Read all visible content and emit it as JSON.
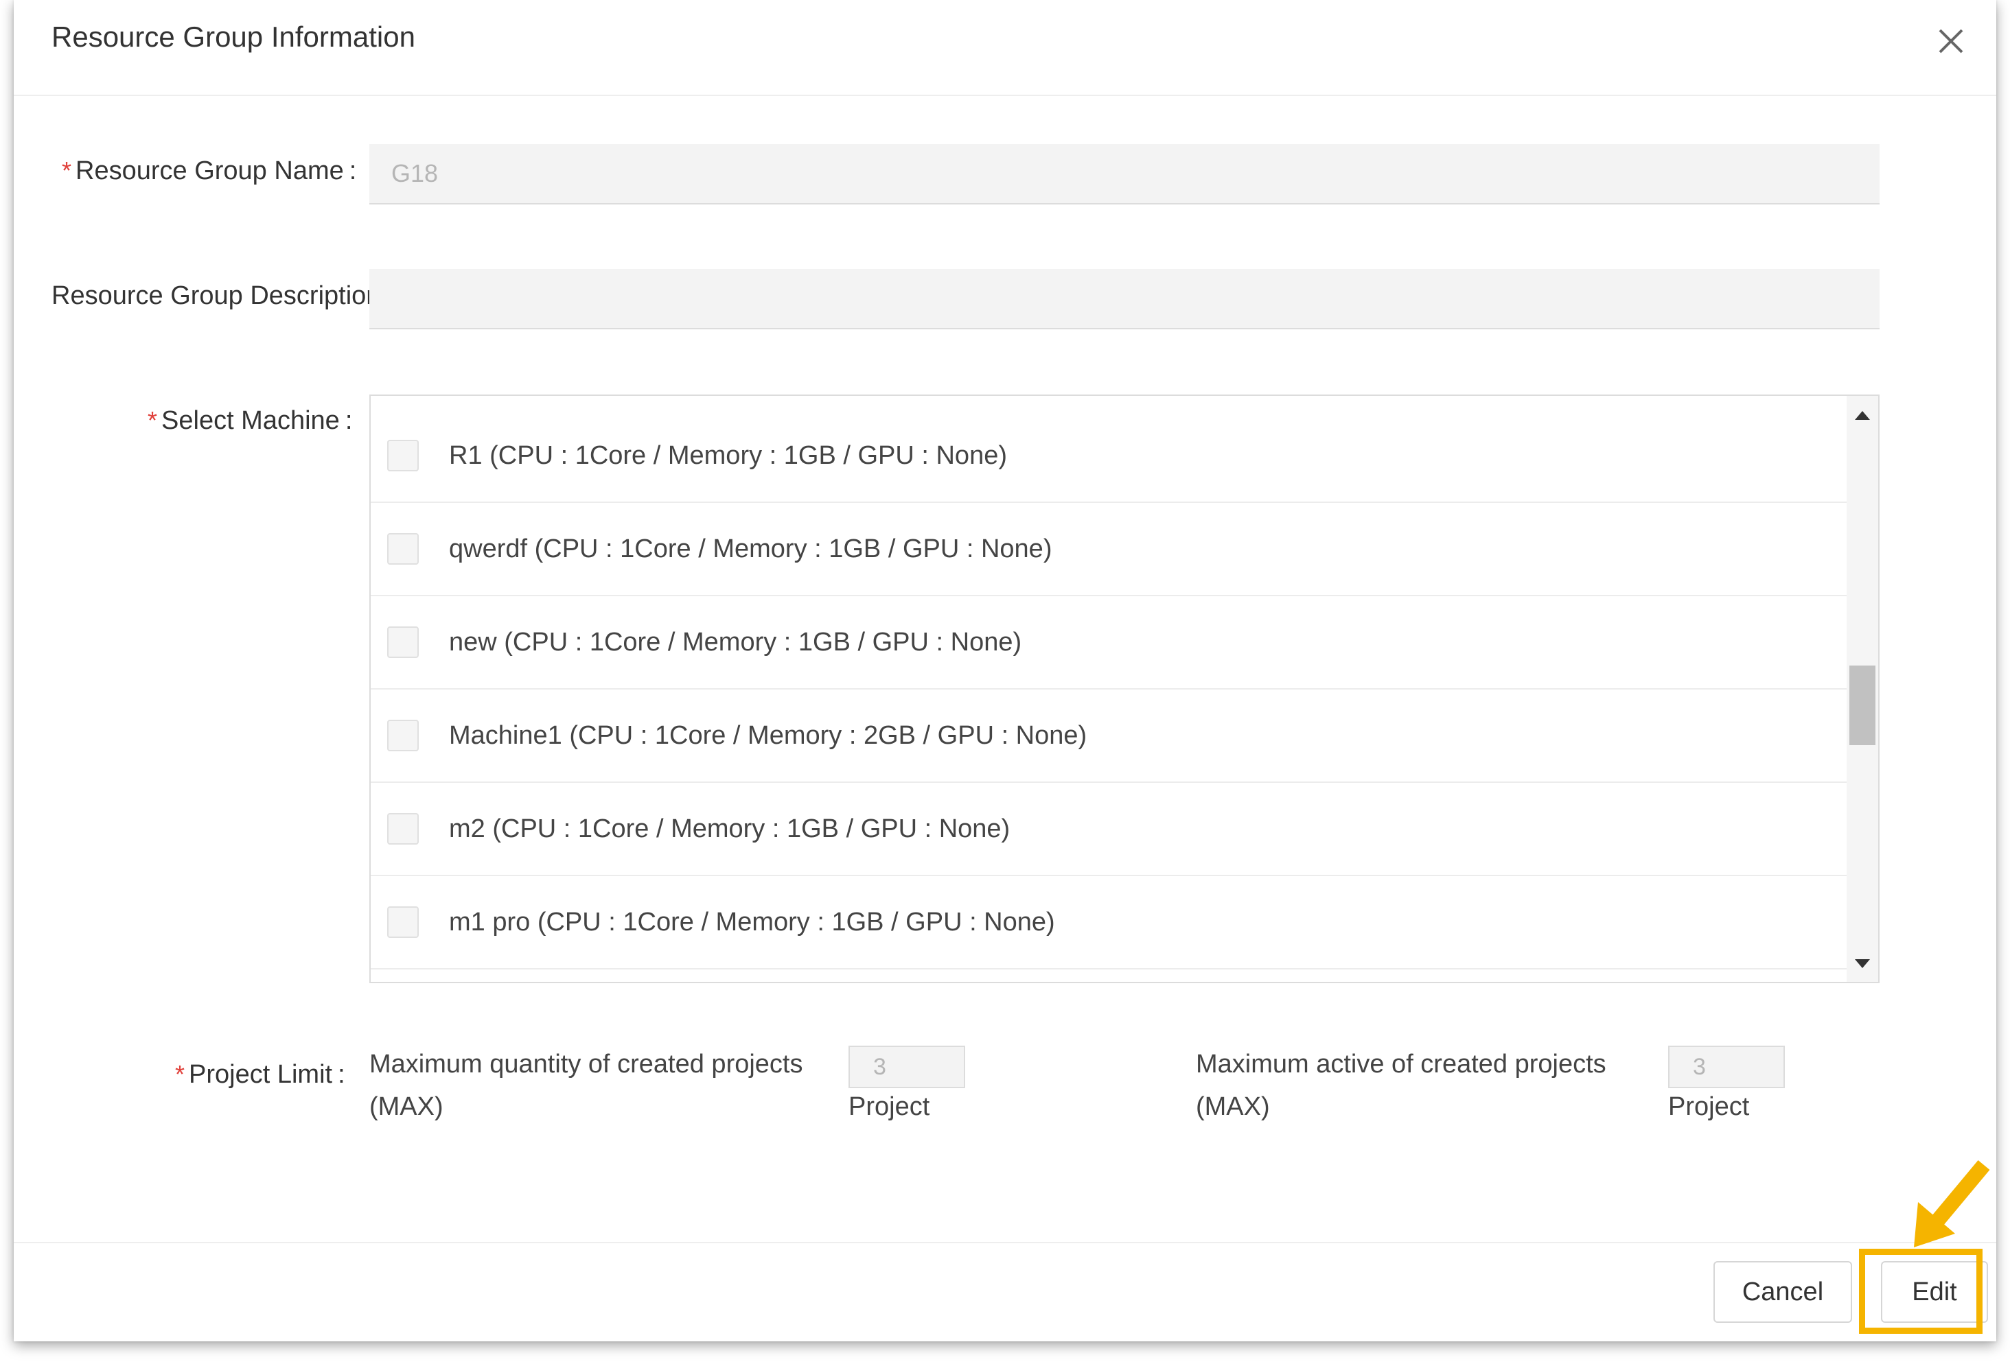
{
  "dialog": {
    "title": "Resource Group Information"
  },
  "form": {
    "required_mark": "*",
    "name_label": "Resource Group Name",
    "name_value": "G18",
    "description_label": "Resource Group Description",
    "description_value": "",
    "machine_label": "Select Machine",
    "label_colon": ":",
    "machines": [
      {
        "label": "R1 (CPU : 1Core / Memory : 1GB / GPU : None)",
        "checked": false
      },
      {
        "label": "qwerdf (CPU : 1Core / Memory : 1GB / GPU : None)",
        "checked": false
      },
      {
        "label": "new (CPU : 1Core / Memory : 1GB / GPU : None)",
        "checked": false
      },
      {
        "label": "Machine1 (CPU : 1Core / Memory : 2GB / GPU : None)",
        "checked": false
      },
      {
        "label": "m2 (CPU : 1Core / Memory : 1GB / GPU : None)",
        "checked": false
      },
      {
        "label": "m1 pro (CPU : 1Core / Memory : 1GB / GPU : None)",
        "checked": false
      }
    ],
    "project_limit_label": "Project Limit",
    "max_quantity_line1": "Maximum quantity of created projects",
    "max_quantity_line2": "(MAX)",
    "max_quantity_value": "3",
    "max_active_line1": "Maximum active of created projects",
    "max_active_line2": "(MAX)",
    "max_active_value": "3",
    "unit": "Project"
  },
  "footer": {
    "cancel_label": "Cancel",
    "edit_label": "Edit"
  },
  "colors": {
    "required": "#e0403a",
    "highlight": "#f5b400"
  },
  "icons": {
    "close": "close-icon",
    "scroll_up": "scroll-up-arrow-icon",
    "scroll_down": "scroll-down-arrow-icon",
    "callout": "callout-arrow-icon"
  }
}
